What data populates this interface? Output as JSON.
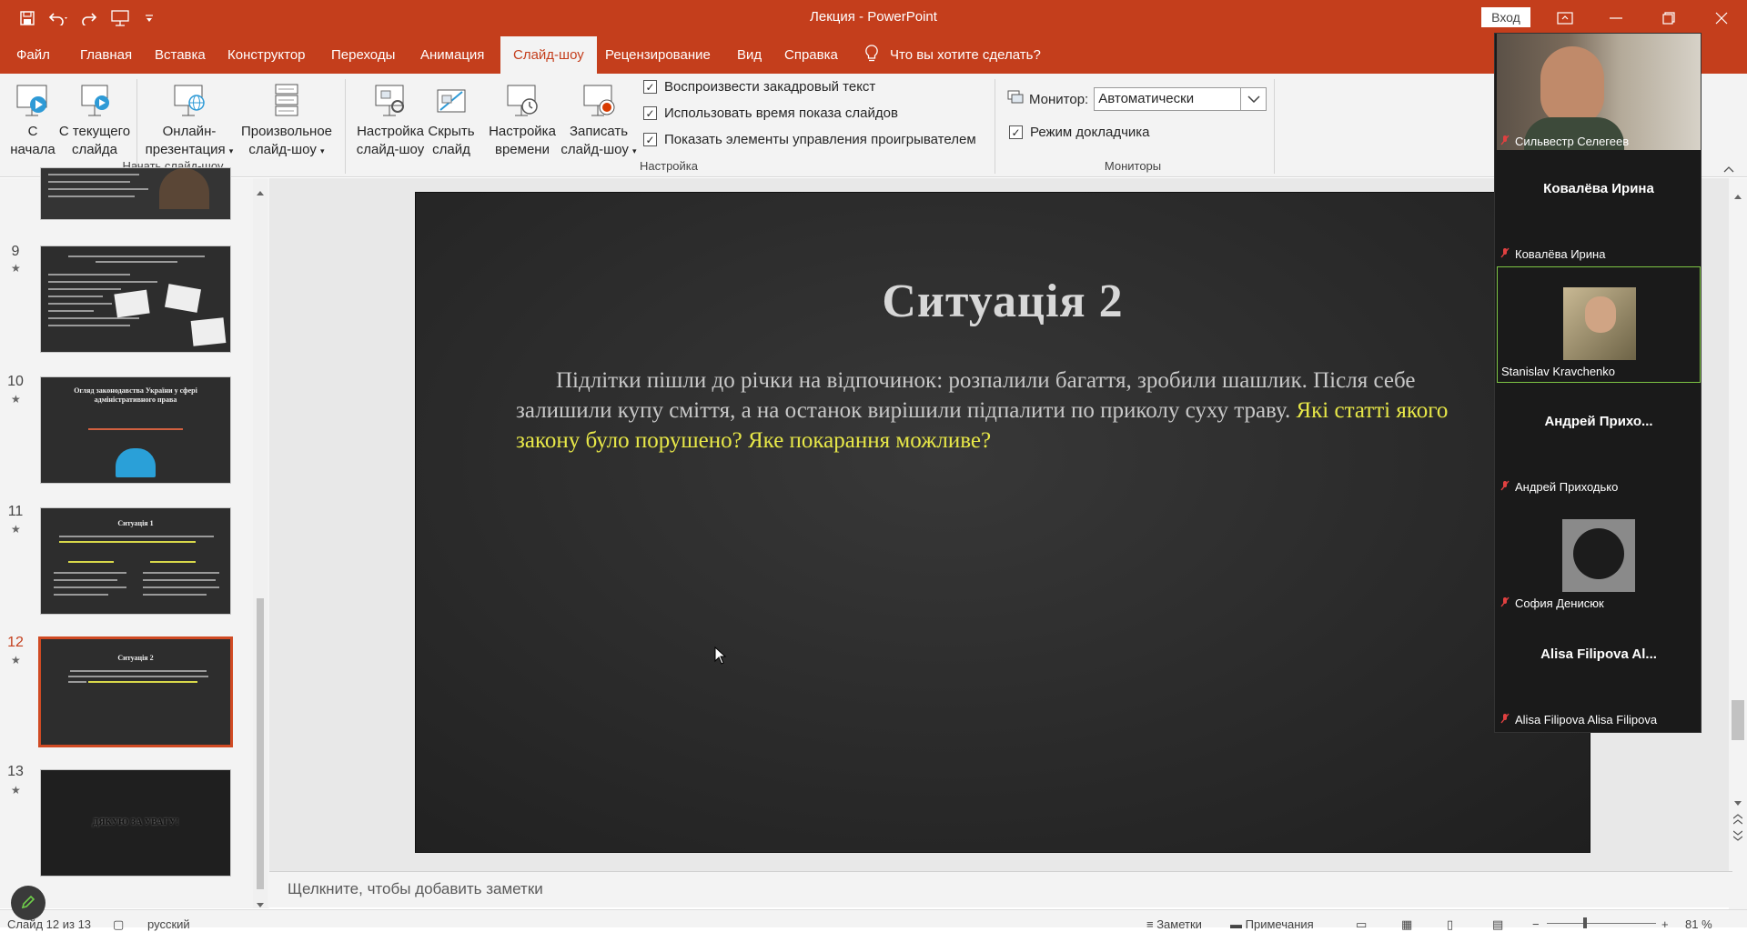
{
  "title_bar": {
    "document_title": "Лекция  -  PowerPoint",
    "sign_in": "Вход",
    "icons": [
      "save-icon",
      "undo-icon",
      "redo-icon",
      "present-from-start-icon",
      "customize-qat-icon"
    ]
  },
  "tabs": [
    {
      "label": "Файл"
    },
    {
      "label": "Главная"
    },
    {
      "label": "Вставка"
    },
    {
      "label": "Конструктор"
    },
    {
      "label": "Переходы"
    },
    {
      "label": "Анимация"
    },
    {
      "label": "Слайд-шоу",
      "active": true
    },
    {
      "label": "Рецензирование"
    },
    {
      "label": "Вид"
    },
    {
      "label": "Справка"
    }
  ],
  "tell_me": "Что вы хотите сделать?",
  "ribbon": {
    "start_group": {
      "label": "Начать слайд-шоу",
      "from_start": [
        "С",
        "начала"
      ],
      "from_current": [
        "С текущего",
        "слайда"
      ],
      "online": [
        "Онлайн-",
        "презентация"
      ],
      "custom": [
        "Произвольное",
        "слайд-шоу"
      ]
    },
    "setup_group": {
      "label": "Настройка",
      "setup_show": [
        "Настройка",
        "слайд-шоу"
      ],
      "hide_slide": [
        "Скрыть",
        "слайд"
      ],
      "rehearse": [
        "Настройка",
        "времени"
      ],
      "record": [
        "Записать",
        "слайд-шоу"
      ],
      "checkboxes": [
        {
          "label": "Воспроизвести закадровый текст",
          "checked": true
        },
        {
          "label": "Использовать время показа слайдов",
          "checked": true
        },
        {
          "label": "Показать элементы управления проигрывателем",
          "checked": true
        }
      ]
    },
    "monitors_group": {
      "label": "Мониторы",
      "monitor_label": "Монитор:",
      "monitor_value": "Автоматически",
      "presenter_view": {
        "label": "Режим докладчика",
        "checked": true
      }
    }
  },
  "thumbnails": [
    {
      "number": "9"
    },
    {
      "number": "10",
      "title": "Огляд законодавства України у сфері адміністративного права"
    },
    {
      "number": "11",
      "title": "Ситуація 1"
    },
    {
      "number": "12",
      "title": "Ситуація 2",
      "selected": true
    },
    {
      "number": "13",
      "title": "ДЯКУЮ ЗА УВАГУ!"
    }
  ],
  "slide": {
    "title": "Ситуація 2",
    "body_plain": "Підлітки пішли до річки на відпочинок: розпалили багаття, зробили шашлик. Після себе залишили купу сміття, а на останок  вирішили підпалити по приколу суху траву. ",
    "body_highlight": "Які статті якого закону було порушено? Яке покарання можливе?"
  },
  "notes_placeholder": "Щелкните, чтобы добавить заметки",
  "status_bar": {
    "slide_counter": "Слайд 12 из 13",
    "language": "русский",
    "notes": "Заметки",
    "comments": "Примечания",
    "zoom": "81 %"
  },
  "participants": [
    {
      "name": "Сильвестр Селегеев",
      "muted": true,
      "video": true
    },
    {
      "name": "Ковалёва Ирина",
      "display": "Ковалёва Ирина",
      "muted": true
    },
    {
      "name": "Stanislav Kravchenko",
      "muted": false,
      "video": true,
      "active": true
    },
    {
      "name": "Андрей Приходько",
      "display": "Андрей  Прихо...",
      "muted": true
    },
    {
      "name": "София Денисюк",
      "muted": true,
      "video": true
    },
    {
      "name": "Alisa Filipova Alisa Filipova",
      "display": "Alisa Filipova Al...",
      "muted": true
    }
  ],
  "colors": {
    "accent": "#c43e1c",
    "highlight_text": "#e8e848",
    "active_speaker": "#7ec544"
  }
}
